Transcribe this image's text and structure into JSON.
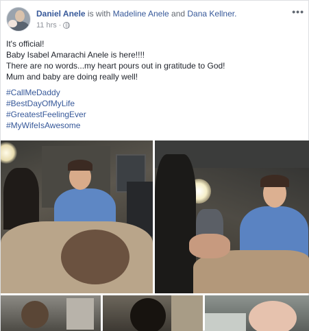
{
  "post": {
    "author": "Daniel Anele",
    "with_text": "is with",
    "tagged_1": "Madeline Anele",
    "and_text": "and",
    "tagged_2": "Dana Kellner.",
    "time": "11 hrs",
    "separator": "·",
    "privacy_icon": "globe-icon",
    "more_label": "•••",
    "body_lines": [
      "It's official!",
      "Baby Isabel Amarachi Anele is here!!!!",
      "There are no words...my heart pours out in gratitude to God!",
      "Mum and baby are doing really well!"
    ],
    "hashtags": [
      "#CallMeDaddy",
      "#BestDayOfMyLife",
      "#GreatestFeelingEver",
      "#MyWifeIsAwesome"
    ]
  },
  "colors": {
    "link": "#365899",
    "text": "#1d2129",
    "muted": "#90949c"
  }
}
